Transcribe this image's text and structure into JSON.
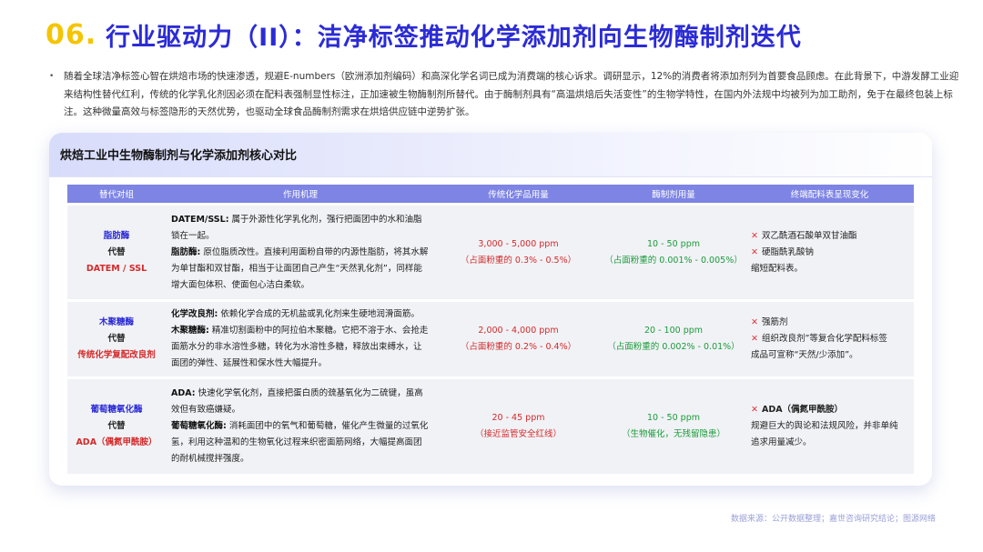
{
  "title": {
    "number": "06.",
    "text": "行业驱动力（II）：洁净标签推动化学添加剂向生物酶制剂迭代"
  },
  "intro": {
    "bullet": "•",
    "text": "随着全球洁净标签心智在烘焙市场的快速渗透，规避E-numbers（欧洲添加剂编码）和高深化学名词已成为消费端的核心诉求。调研显示，12%的消费者将添加剂列为首要食品顾虑。在此背景下，中游发酵工业迎来结构性替代红利，传统的化学乳化剂因必须在配料表强制显性标注，正加速被生物酶制剂所替代。由于酶制剂具有“高温烘焙后失活变性”的生物学特性，在国内外法规中均被列为加工助剂，免于在最终包装上标注。这种微量高效与标签隐形的天然优势，也驱动全球食品酶制剂需求在烘焙供应链中逆势扩张。"
  },
  "card": {
    "title": "烘焙工业中生物酶制剂与化学添加剂核心对比"
  },
  "table": {
    "headers": [
      "替代对组",
      "作用机理",
      "传统化学品用量",
      "酶制剂用量",
      "终端配料表呈现变化"
    ],
    "rows": [
      {
        "group_name": "脂肪酶",
        "group_mid": "代替",
        "group_old": "DATEM / SSL",
        "mech_1_title": "DATEM/SSL:",
        "mech_1_text": "属于外源性化学乳化剂，强行把面团中的水和油脂锁在一起。",
        "mech_2_title": "脂肪酶:",
        "mech_2_text": "原位脂质改性。直接利用面粉自带的内源性脂肪，将其水解为单甘酯和双甘酯，相当于让面团自己产生“天然乳化剂”，同样能增大面包体积、使面包心洁白柔软。",
        "chem_amount": "3,000 - 5,000 ppm",
        "chem_note": "（占面粉重的 0.3% - 0.5%）",
        "enz_amount": "10 - 50 ppm",
        "enz_note": "（占面粉重的 0.001% - 0.005%）",
        "label_1": "双乙酰酒石酸单双甘油酯",
        "label_2": "硬脂酰乳酸钠",
        "label_3": "缩短配料表。"
      },
      {
        "group_name": "木聚糖酶",
        "group_mid": "代替",
        "group_old": "传统化学复配改良剂",
        "mech_1_title": "化学改良剂:",
        "mech_1_text": "依赖化学合成的无机盐或乳化剂来生硬地润滑面筋。",
        "mech_2_title": "木聚糖酶:",
        "mech_2_text": "精准切割面粉中的阿拉伯木聚糖。它把不溶于水、会抢走面筋水分的非水溶性多糖，转化为水溶性多糖，释放出束缚水，让面团的弹性、延展性和保水性大幅提升。",
        "chem_amount": "2,000 - 4,000 ppm",
        "chem_note": "（占面粉重的 0.2% - 0.4%）",
        "enz_amount": "20 - 100 ppm",
        "enz_note": "（占面粉重的 0.002% - 0.01%）",
        "label_1": "强筋剂",
        "label_2": "组织改良剂”等复合化学配料标签",
        "label_3": "成品可宣称“天然/少添加”。"
      },
      {
        "group_name": "葡萄糖氧化酶",
        "group_mid": "代替",
        "group_old": "ADA（偶氮甲酰胺）",
        "mech_1_title": "ADA:",
        "mech_1_text": "快速化学氧化剂，直接把蛋白质的巯基氧化为二硫键，虽高效但有致癌嫌疑。",
        "mech_2_title": "葡萄糖氧化酶:",
        "mech_2_text": "消耗面团中的氧气和葡萄糖，催化产生微量的过氧化氢，利用这种温和的生物氧化过程来织密面筋网络，大幅提高面团的耐机械搅拌强度。",
        "chem_amount": "20 - 45 ppm",
        "chem_note": "（接近监管安全红线）",
        "enz_amount": "10 - 50 ppm",
        "enz_note": "（生物催化，无残留隐患）",
        "label_1": "ADA（偶氮甲酰胺）",
        "label_2": "规避巨大的舆论和法规风险，并非单纯",
        "label_3": "追求用量减少。"
      }
    ]
  },
  "footer": "数据来源：公开数据整理；嘉世咨询研究结论；图源网络",
  "colors": {
    "title_number": "#f5c400",
    "title_text": "#2b2bd6",
    "table_header_bg": "#7d84e4",
    "chem_red": "#d42a2a",
    "enzyme_green": "#1a9b3a"
  },
  "icons": {
    "cross": "cross-mark-icon"
  }
}
